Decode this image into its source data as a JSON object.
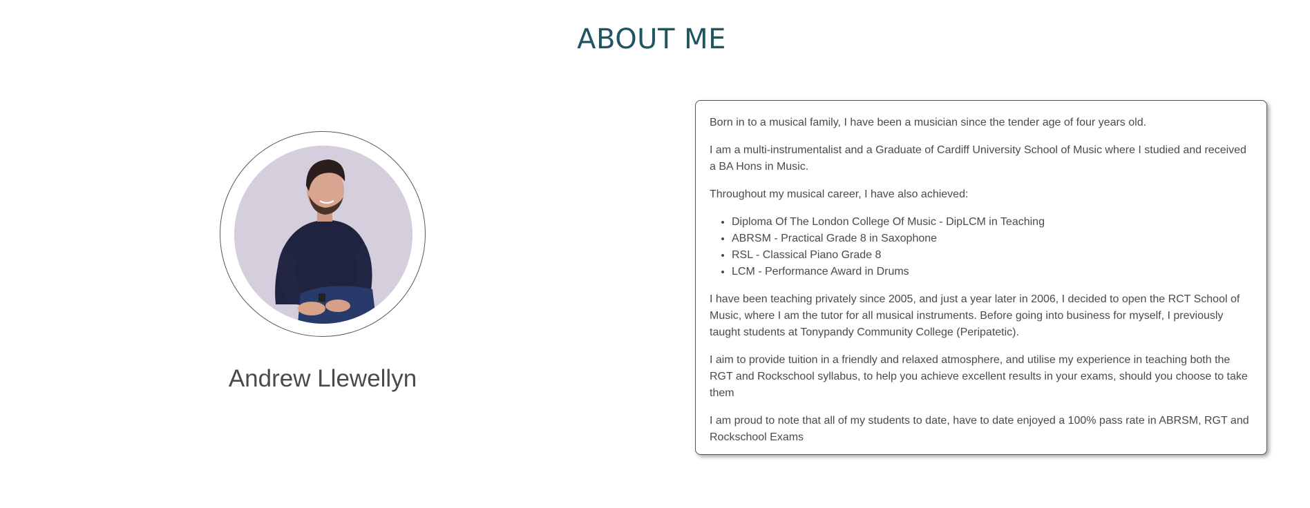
{
  "about": {
    "title": "ABOUT ME"
  },
  "profile": {
    "name": "Andrew Llewellyn",
    "photo_icon": "portrait-photo"
  },
  "bio": {
    "p1": "Born in to a musical family, I have been a musician since the tender age of four years old.",
    "p2": "I am a multi-instrumentalist and a Graduate of Cardiff University School of Music where I studied and received a BA Hons in Music.",
    "p3": "Throughout my musical career, I have also achieved:",
    "achievements": [
      "Diploma Of The London College Of Music - DipLCM in Teaching",
      "ABRSM - Practical Grade 8 in Saxophone",
      "RSL - Classical Piano Grade 8",
      "LCM - Performance Award in Drums"
    ],
    "p4": "I have been teaching privately since 2005, and just a year later in 2006, I decided to open the RCT School of Music, where I am the tutor for all musical instruments. Before going into business for myself, I previously taught students at Tonypandy Community College (Peripatetic).",
    "p5": "I aim to provide tuition in a friendly and relaxed atmosphere, and utilise my experience in teaching both the RGT and Rockschool syllabus, to help you achieve excellent results in your exams, should you choose to take them",
    "p6": "I am proud to note that all of my students to date, have to date enjoyed a 100% pass rate in ABRSM, RGT and Rockschool Exams"
  },
  "colors": {
    "title": "#1f5462",
    "text": "#4a4a4a",
    "border": "#555555"
  }
}
